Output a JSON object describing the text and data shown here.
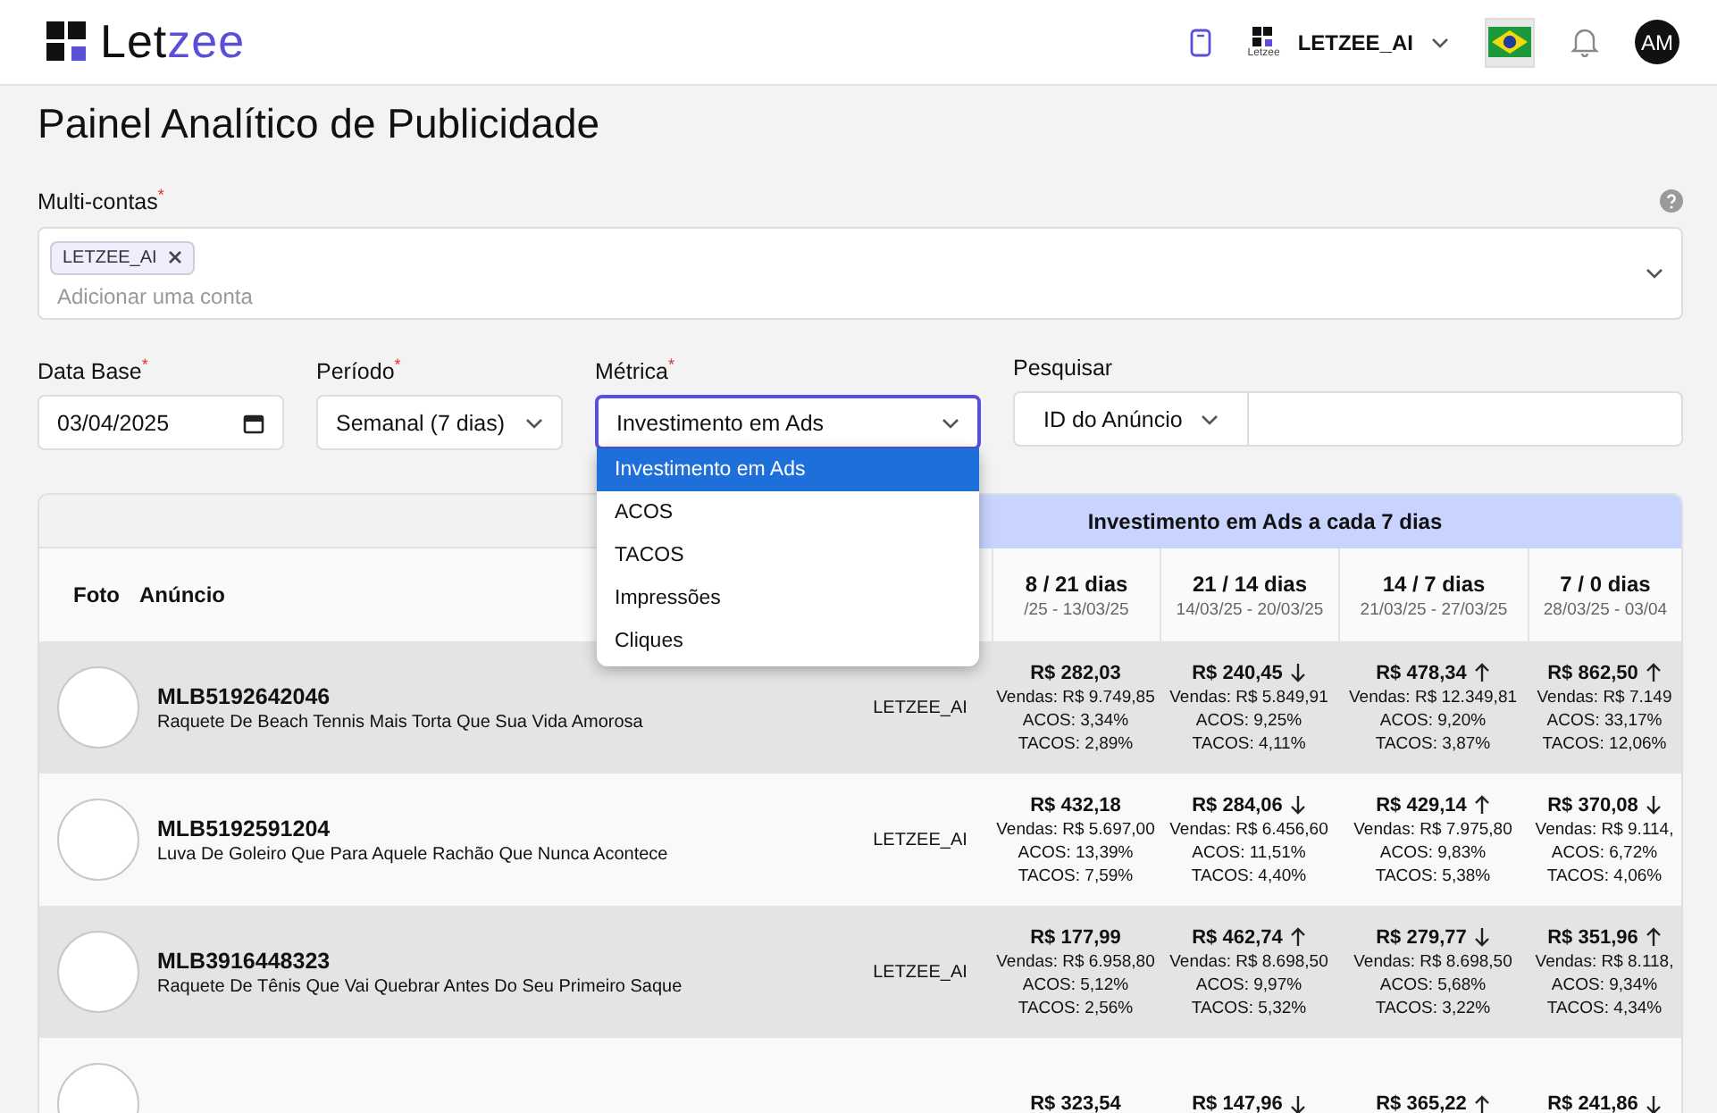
{
  "brand": {
    "prefix": "Let",
    "suffix": "zee"
  },
  "topbar": {
    "account_logo_caption": "Letzee",
    "account": "LETZEE_AI",
    "avatar": "AM"
  },
  "title": "Painel Analítico de Publicidade",
  "multi_accounts": {
    "label": "Multi-contas$^{*}$",
    "chips": [
      "LETZEE_AI"
    ],
    "placeholder": "Adicionar uma conta"
  },
  "filters": {
    "base_date": {
      "label": "Data Base$^{*}$",
      "value": "03/04/2025"
    },
    "period": {
      "label": "Período$^{*}$",
      "value": "Semanal (7 dias)"
    },
    "metric": {
      "label": "Métrica$^{*}$",
      "value": "Investimento em Ads",
      "expanded": true,
      "options": [
        {
          "label": "Investimento em Ads",
          "selected": true
        },
        {
          "label": "ACOS",
          "selected": false
        },
        {
          "label": "TACOS",
          "selected": false
        },
        {
          "label": "Impressões",
          "selected": false
        },
        {
          "label": "Cliques",
          "selected": false
        }
      ]
    },
    "search": {
      "label": "Pesquisar",
      "field": "ID do Anúncio"
    }
  },
  "table": {
    "band": "Investimento em Ads a cada 7 dias",
    "columns": [
      "Foto",
      "Anúncio"
    ],
    "periods": [
      {
        "title": "8 / 21 dias",
        "dates": "/25 - 13/03/25"
      },
      {
        "title": "21 / 14 dias",
        "dates": "14/03/25 - 20/03/25"
      },
      {
        "title": "14 / 7 dias",
        "dates": "21/03/25 - 27/03/25"
      },
      {
        "title": "7 / 0 dias",
        "dates": "28/03/25 - 03/04"
      }
    ],
    "rows": [
      {
        "id": "MLB5192642046",
        "name": "Raquete De Beach Tennis Mais Torta Que Sua Vida Amorosa",
        "account": "LETZEE_AI",
        "cells": [
          {
            "amount": "R$ 282,03",
            "kind": "plain",
            "sales": "Vendas: R$ 9.749,85",
            "acos": "ACOS: 3,34%",
            "tacos": "TACOS: 2,89%"
          },
          {
            "amount": "R$ 240,45",
            "kind": "down",
            "sales": "Vendas: R$ 5.849,91",
            "acos": "ACOS: 9,25%",
            "tacos": "TACOS: 4,11%"
          },
          {
            "amount": "R$ 478,34",
            "kind": "up",
            "sales": "Vendas: R$ 12.349,81",
            "acos": "ACOS: 9,20%",
            "tacos": "TACOS: 3,87%"
          },
          {
            "amount": "R$ 862,50",
            "kind": "up",
            "sales": "Vendas: R$ 7.149",
            "acos": "ACOS: 33,17%",
            "tacos": "TACOS: 12,06%"
          }
        ]
      },
      {
        "id": "MLB5192591204",
        "name": "Luva De Goleiro Que Para Aquele Rachão Que Nunca Acontece",
        "account": "LETZEE_AI",
        "cells": [
          {
            "amount": "R$ 432,18",
            "kind": "plain",
            "sales": "Vendas: R$ 5.697,00",
            "acos": "ACOS: 13,39%",
            "tacos": "TACOS: 7,59%"
          },
          {
            "amount": "R$ 284,06",
            "kind": "down",
            "sales": "Vendas: R$ 6.456,60",
            "acos": "ACOS: 11,51%",
            "tacos": "TACOS: 4,40%"
          },
          {
            "amount": "R$ 429,14",
            "kind": "up",
            "sales": "Vendas: R$ 7.975,80",
            "acos": "ACOS: 9,83%",
            "tacos": "TACOS: 5,38%"
          },
          {
            "amount": "R$ 370,08",
            "kind": "down",
            "sales": "Vendas: R$ 9.114,",
            "acos": "ACOS: 6,72%",
            "tacos": "TACOS: 4,06%"
          }
        ]
      },
      {
        "id": "MLB3916448323",
        "name": "Raquete De Tênis Que Vai Quebrar Antes Do Seu Primeiro Saque",
        "account": "LETZEE_AI",
        "cells": [
          {
            "amount": "R$ 177,99",
            "kind": "plain",
            "sales": "Vendas: R$ 6.958,80",
            "acos": "ACOS: 5,12%",
            "tacos": "TACOS: 2,56%"
          },
          {
            "amount": "R$ 462,74",
            "kind": "up",
            "sales": "Vendas: R$ 8.698,50",
            "acos": "ACOS: 9,97%",
            "tacos": "TACOS: 5,32%"
          },
          {
            "amount": "R$ 279,77",
            "kind": "down",
            "sales": "Vendas: R$ 8.698,50",
            "acos": "ACOS: 5,68%",
            "tacos": "TACOS: 3,22%"
          },
          {
            "amount": "R$ 351,96",
            "kind": "up",
            "sales": "Vendas: R$ 8.118,",
            "acos": "ACOS: 9,34%",
            "tacos": "TACOS: 4,34%"
          }
        ]
      },
      {
        "cells": [
          {
            "amount": "R$ 323,54",
            "kind": "plain"
          },
          {
            "amount": "R$ 147,96",
            "kind": "down"
          },
          {
            "amount": "R$ 365,22",
            "kind": "up"
          },
          {
            "amount": "R$ 241,86",
            "kind": "down"
          }
        ]
      }
    ]
  }
}
